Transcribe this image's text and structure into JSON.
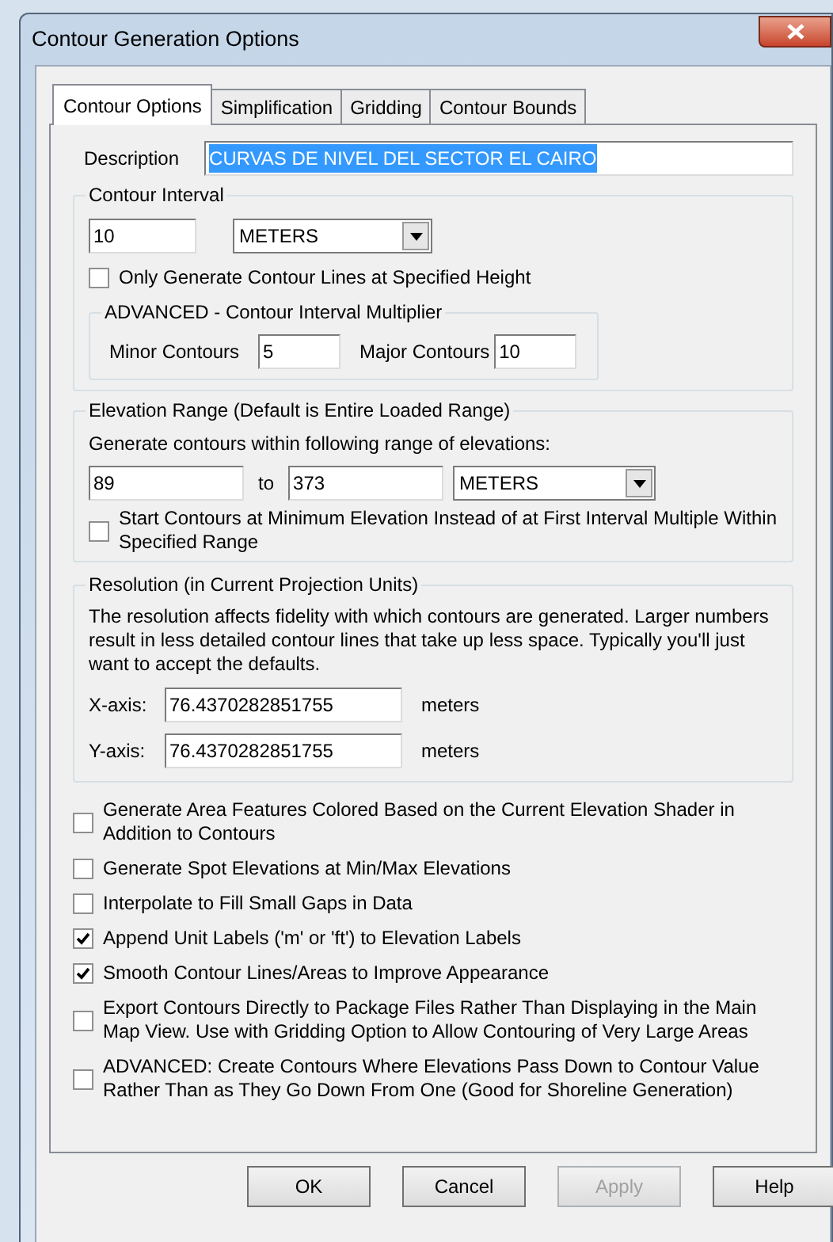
{
  "window": {
    "title": "Contour Generation Options"
  },
  "tabs": [
    {
      "label": "Contour Options",
      "selected": true
    },
    {
      "label": "Simplification",
      "selected": false
    },
    {
      "label": "Gridding",
      "selected": false
    },
    {
      "label": "Contour Bounds",
      "selected": false
    }
  ],
  "description": {
    "label": "Description",
    "value": "CURVAS DE NIVEL DEL SECTOR EL CAIRO",
    "text_selected": true
  },
  "contour_interval": {
    "title": "Contour Interval",
    "value": "10",
    "unit": "METERS",
    "only_specified": {
      "label": "Only Generate Contour Lines at Specified Height",
      "checked": false
    },
    "advanced": {
      "title": "ADVANCED - Contour Interval Multiplier",
      "minor_label": "Minor Contours",
      "minor_value": "5",
      "major_label": "Major Contours",
      "major_value": "10"
    }
  },
  "elevation_range": {
    "title": "Elevation Range (Default is Entire Loaded Range)",
    "prompt": "Generate contours within following range of elevations:",
    "from": "89",
    "to_label": "to",
    "to": "373",
    "unit": "METERS",
    "start_at_min": {
      "label": "Start Contours at Minimum Elevation Instead of at First Interval Multiple Within Specified Range",
      "checked": false
    }
  },
  "resolution": {
    "title": "Resolution (in Current Projection Units)",
    "note": "The resolution affects fidelity with which contours are generated. Larger numbers result in less detailed contour lines that take up less space. Typically you'll just want to accept the defaults.",
    "axes": [
      {
        "label": "X-axis:",
        "value": "76.4370282851755",
        "unit": "meters"
      },
      {
        "label": "Y-axis:",
        "value": "76.4370282851755",
        "unit": "meters"
      }
    ]
  },
  "options": [
    {
      "label": "Generate Area Features Colored Based on the Current Elevation Shader in Addition to Contours",
      "checked": false
    },
    {
      "label": "Generate Spot Elevations at Min/Max Elevations",
      "checked": false
    },
    {
      "label": "Interpolate to Fill Small Gaps in Data",
      "checked": false
    },
    {
      "label": "Append Unit Labels ('m' or 'ft') to Elevation Labels",
      "checked": true
    },
    {
      "label": "Smooth Contour Lines/Areas to Improve Appearance",
      "checked": true
    },
    {
      "label": "Export Contours Directly to Package Files Rather Than Displaying in the Main Map View. Use with Gridding Option to Allow Contouring of Very Large Areas",
      "checked": false
    },
    {
      "label": "ADVANCED: Create Contours Where Elevations Pass Down to Contour Value Rather Than as They Go Down From One (Good for Shoreline Generation)",
      "checked": false
    }
  ],
  "buttons": [
    {
      "label": "OK",
      "disabled": false
    },
    {
      "label": "Cancel",
      "disabled": false
    },
    {
      "label": "Apply",
      "disabled": true
    },
    {
      "label": "Help",
      "disabled": false
    }
  ]
}
